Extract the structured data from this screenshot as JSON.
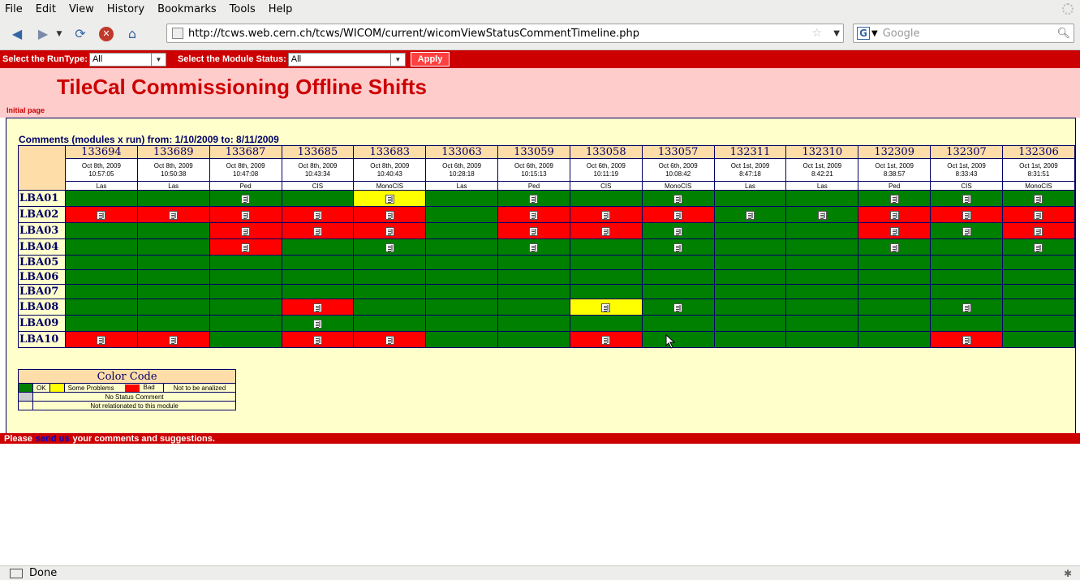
{
  "browser": {
    "menu": [
      "File",
      "Edit",
      "View",
      "History",
      "Bookmarks",
      "Tools",
      "Help"
    ],
    "url": "http://tcws.web.cern.ch/tcws/WICOM/current/wicomViewStatusCommentTimeline.php",
    "search_placeholder": "Google",
    "status": "Done"
  },
  "filters": {
    "runtype_label": "Select the RunType:",
    "runtype_value": "All",
    "status_label": "Select the Module Status:",
    "status_value": "All",
    "apply_label": "Apply"
  },
  "header": {
    "title": "TileCal Commissioning Offline Shifts",
    "initial_page": "Initial page"
  },
  "comments_title": "Comments (modules x run) from: 1/10/2009 to: 8/11/2009",
  "runs": [
    {
      "run": "133694",
      "date": "Oct 8th, 2009",
      "time": "10:57:05",
      "type": "Las"
    },
    {
      "run": "133689",
      "date": "Oct 8th, 2009",
      "time": "10:50:38",
      "type": "Las"
    },
    {
      "run": "133687",
      "date": "Oct 8th, 2009",
      "time": "10:47:08",
      "type": "Ped"
    },
    {
      "run": "133685",
      "date": "Oct 8th, 2009",
      "time": "10:43:34",
      "type": "CIS"
    },
    {
      "run": "133683",
      "date": "Oct 8th, 2009",
      "time": "10:40:43",
      "type": "MonoCIS"
    },
    {
      "run": "133063",
      "date": "Oct 6th, 2009",
      "time": "10:28:18",
      "type": "Las"
    },
    {
      "run": "133059",
      "date": "Oct 6th, 2009",
      "time": "10:15:13",
      "type": "Ped"
    },
    {
      "run": "133058",
      "date": "Oct 6th, 2009",
      "time": "10:11:19",
      "type": "CIS"
    },
    {
      "run": "133057",
      "date": "Oct 6th, 2009",
      "time": "10:08:42",
      "type": "MonoCIS"
    },
    {
      "run": "132311",
      "date": "Oct 1st, 2009",
      "time": "8:47:18",
      "type": "Las"
    },
    {
      "run": "132310",
      "date": "Oct 1st, 2009",
      "time": "8:42:21",
      "type": "Las"
    },
    {
      "run": "132309",
      "date": "Oct 1st, 2009",
      "time": "8:38:57",
      "type": "Ped"
    },
    {
      "run": "132307",
      "date": "Oct 1st, 2009",
      "time": "8:33:43",
      "type": "CIS"
    },
    {
      "run": "132306",
      "date": "Oct 1st, 2009",
      "time": "8:31:51",
      "type": "MonoCIS"
    }
  ],
  "status_key": {
    "g": "ok",
    "r": "bad",
    "y": "some-problems"
  },
  "modules": [
    {
      "name": "LBA01",
      "cells": [
        "g",
        "g",
        "g*",
        "g",
        "y*",
        "g",
        "g*",
        "g",
        "g*",
        "g",
        "g",
        "g*",
        "g*",
        "g*"
      ]
    },
    {
      "name": "LBA02",
      "cells": [
        "r*",
        "r*",
        "r*",
        "r*",
        "r*",
        "g",
        "r*",
        "r*",
        "r*",
        "g*",
        "g*",
        "r*",
        "r*",
        "r*"
      ]
    },
    {
      "name": "LBA03",
      "cells": [
        "g",
        "g",
        "r*",
        "r*",
        "r*",
        "g",
        "r*",
        "r*",
        "g*",
        "g",
        "g",
        "r*",
        "g*",
        "r*"
      ]
    },
    {
      "name": "LBA04",
      "cells": [
        "g",
        "g",
        "r*",
        "g",
        "g*",
        "g",
        "g*",
        "g",
        "g*",
        "g",
        "g",
        "g*",
        "g",
        "g*"
      ]
    },
    {
      "name": "LBA05",
      "cells": [
        "g",
        "g",
        "g",
        "g",
        "g",
        "g",
        "g",
        "g",
        "g",
        "g",
        "g",
        "g",
        "g",
        "g"
      ]
    },
    {
      "name": "LBA06",
      "cells": [
        "g",
        "g",
        "g",
        "g",
        "g",
        "g",
        "g",
        "g",
        "g",
        "g",
        "g",
        "g",
        "g",
        "g"
      ]
    },
    {
      "name": "LBA07",
      "cells": [
        "g",
        "g",
        "g",
        "g",
        "g",
        "g",
        "g",
        "g",
        "g",
        "g",
        "g",
        "g",
        "g",
        "g"
      ]
    },
    {
      "name": "LBA08",
      "cells": [
        "g",
        "g",
        "g",
        "r*",
        "g",
        "g",
        "g",
        "y*",
        "g*",
        "g",
        "g",
        "g",
        "g*",
        "g"
      ]
    },
    {
      "name": "LBA09",
      "cells": [
        "g",
        "g",
        "g",
        "g*",
        "g",
        "g",
        "g",
        "g",
        "g",
        "g",
        "g",
        "g",
        "g",
        "g"
      ]
    },
    {
      "name": "LBA10",
      "cells": [
        "r*",
        "r*",
        "g",
        "r*",
        "r*",
        "g",
        "g",
        "r*",
        "g",
        "g",
        "g",
        "g",
        "r*",
        "g"
      ]
    }
  ],
  "legend": {
    "title": "Color Code",
    "ok": "OK",
    "some_problems": "Some Problems",
    "bad": "Bad",
    "not_analized": "Not to be analized",
    "no_comment": "No Status Comment",
    "not_related": "Not relationated to this module",
    "colors": {
      "ok": "#008000",
      "some_problems": "#ffff00",
      "bad": "#ff0000",
      "not_analized": "#ffffff",
      "no_comment": "#cccccc"
    }
  },
  "footer": {
    "prefix": "Please",
    "link": "send us",
    "suffix": "your comments and suggestions."
  }
}
